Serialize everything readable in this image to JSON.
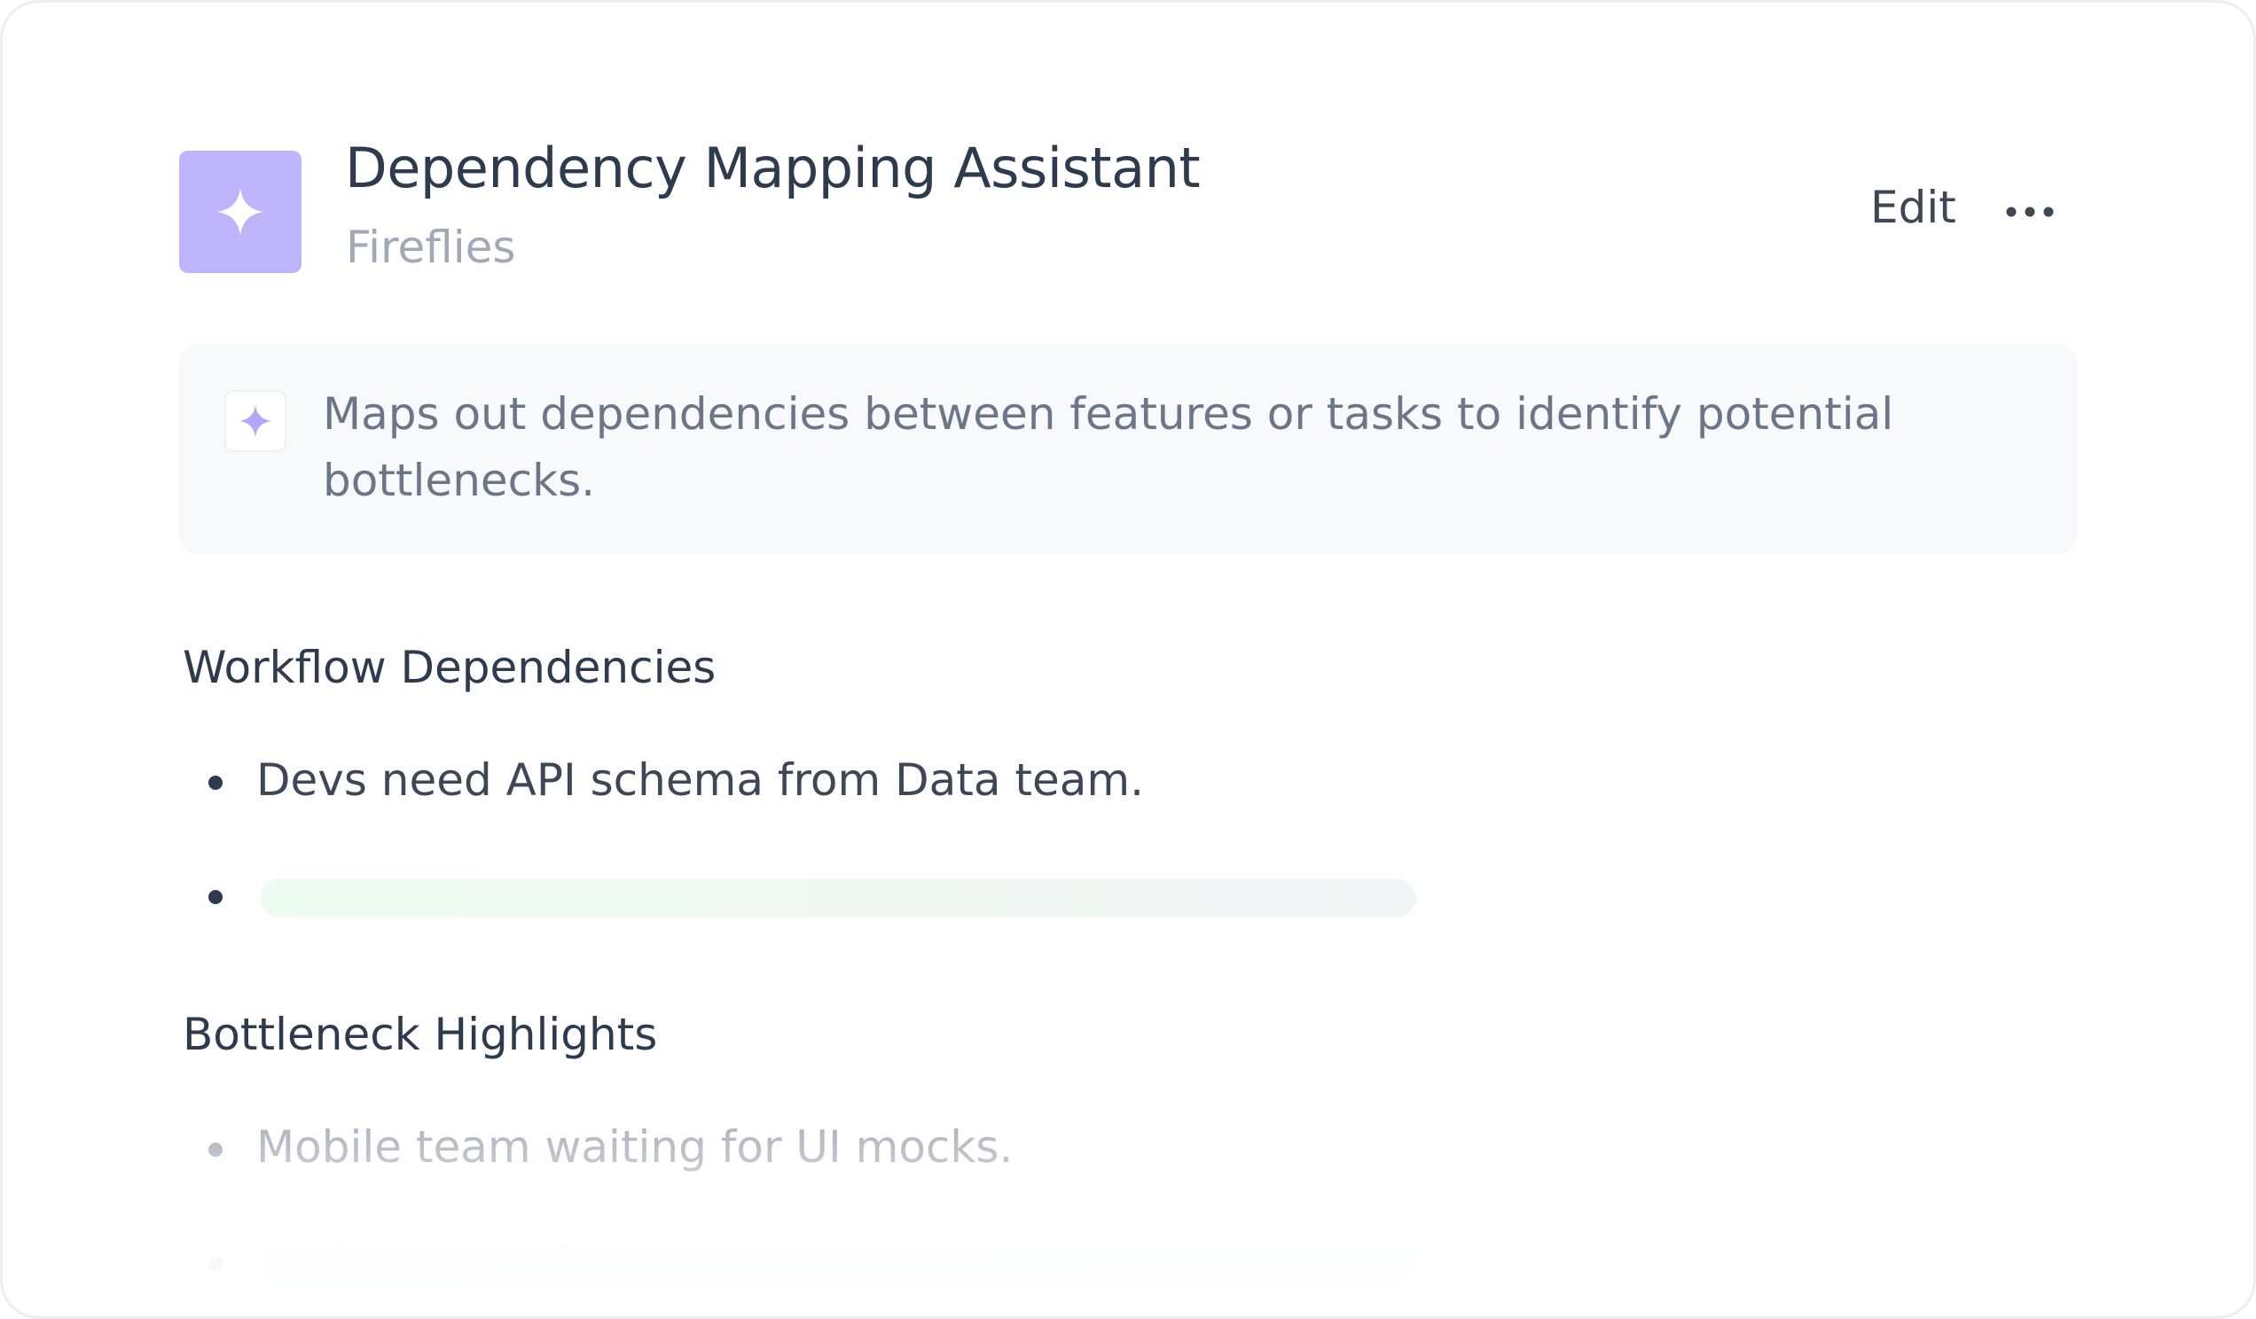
{
  "header": {
    "title": "Dependency Mapping Assistant",
    "subtitle": "Fireflies",
    "edit_label": "Edit",
    "icon": "sparkle-icon",
    "accent_color": "#bdb4fb"
  },
  "description": {
    "icon": "sparkle-icon",
    "text": "Maps out dependencies between features or tasks to identify potential bottlenecks."
  },
  "sections": [
    {
      "heading": "Workflow Dependencies",
      "items": [
        "Devs need API schema from Data team."
      ]
    },
    {
      "heading": "Bottleneck Highlights",
      "items": [
        "Mobile team waiting for UI mocks."
      ]
    }
  ]
}
